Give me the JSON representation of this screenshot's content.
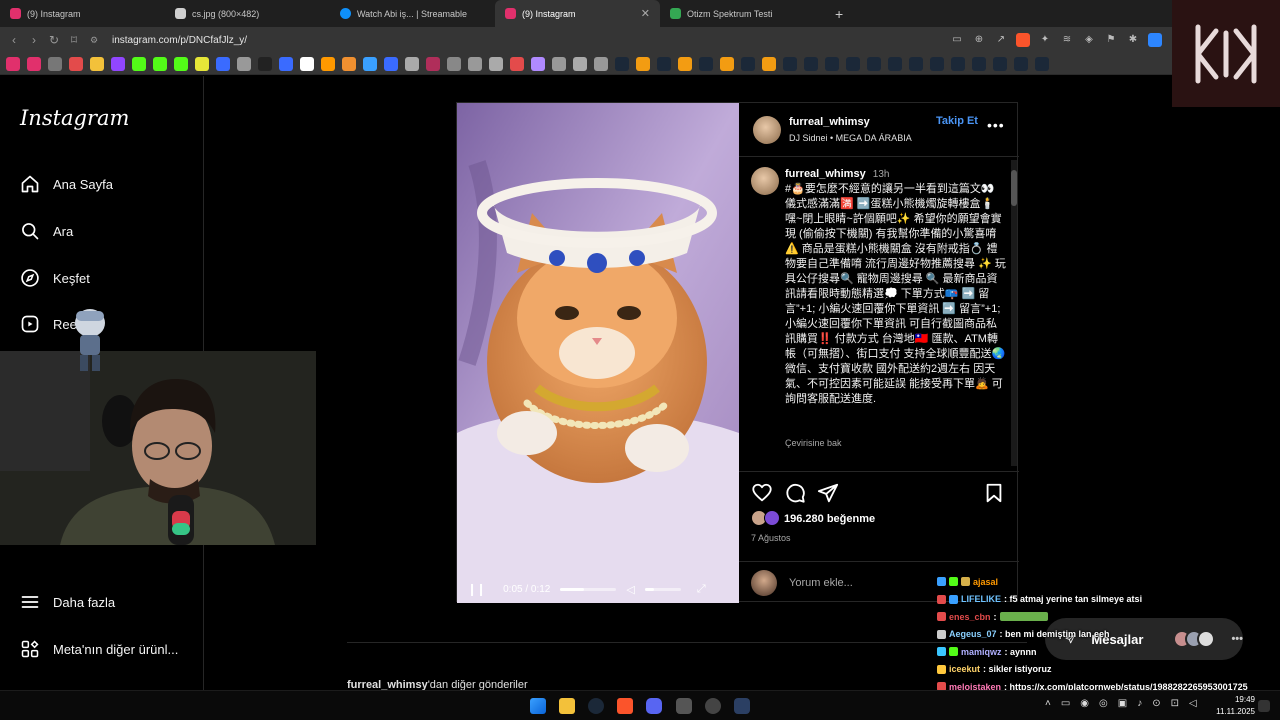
{
  "browser": {
    "tabs": [
      {
        "label": "(9) Instagram",
        "color": "#e1306c",
        "active": false
      },
      {
        "label": "cs.jpg (800×482)",
        "color": "#cfcfcf",
        "active": false
      },
      {
        "label": "Watch Abi iş... | Streamable",
        "color": "#0f90fa",
        "active": false
      },
      {
        "label": "(9) Instagram",
        "color": "#e1306c",
        "active": true
      },
      {
        "label": "Otizm Spektrum Testi",
        "color": "#34a853",
        "active": false
      }
    ],
    "url": "instagram.com/p/DNCfafJlz_y/"
  },
  "sidebar": {
    "logo": "Instagram",
    "items": [
      {
        "label": "Ana Sayfa",
        "icon": "home-icon"
      },
      {
        "label": "Ara",
        "icon": "search-icon"
      },
      {
        "label": "Keşfet",
        "icon": "compass-icon"
      },
      {
        "label": "Reels",
        "icon": "reels-icon"
      }
    ],
    "more": "Daha fazla",
    "meta": "Meta'nın diğer ürünl..."
  },
  "post": {
    "username": "furreal_whimsy",
    "follow": "Takip Et",
    "audio": "DJ Sidnei • MEGA DA ÁRABIA",
    "caption_time": "13h",
    "caption": "#🎂要怎麼不經意的讓另一半看到這篇文👀 儀式感滿滿🈵 ➡️蛋糕小熊機燭旋轉樓盒🕯️ 嘿~閉上眼睛~許個願吧✨ 希望你的願望會實現 (偷偷按下機關) 有我幫你準備的小驚喜唷 ⚠️ 商品是蛋糕小熊機關盒 沒有附戒指💍 禮物要自己準備唷 流行周邊好物推薦搜尋 ✨ 玩具公仔搜尋🔍 寵物周邊搜尋 🔍 最新商品資訊請看限時動態精選💭 下單方式📪 ➡️ 留言”+1; 小編火速回覆你下單資訊 ➡️ 留言”+1; 小編火速回覆你下單資訊 可自行截圖商品私訊購買‼️ 付款方式 台灣地🇹🇼 匯款、ATM轉帳（可無摺）、街口支付 支持全球順豐配送🌏微信、支付寶收款 國外配送約2週左右 因天氣、不可控因素可能延誤 能接受再下單🙇 可詢問客服配送進度.",
    "see_translation": "Çevirisine bak",
    "likes": "196.280 beğenme",
    "date": "7 Ağustos",
    "comment_placeholder": "Yorum ekle...",
    "video_time": "0:05 / 0:12",
    "video_progress": 0.42,
    "volume_level": 0.25,
    "more_posts_user": "furreal_whimsy",
    "more_posts_suffix": "'dan diğer gönderiler"
  },
  "messages": {
    "label": "Mesajlar"
  },
  "chat": [
    {
      "user": "ajasal",
      "text": "",
      "color": "#ff9900"
    },
    {
      "user": "LIFELIKE",
      "text": ": f5 atmaj yerine tan silmeye atsi",
      "color": "#6fc3ff"
    },
    {
      "user": "enes_cbn",
      "text": ": ",
      "color": "#e14b4b"
    },
    {
      "user": "Aegeus_07",
      "text": ": ben mi demiştim lan eeh",
      "color": "#8ad0ff"
    },
    {
      "user": "mamiqwz",
      "text": ": aynnn",
      "color": "#b0b0ff"
    },
    {
      "user": "iceekut",
      "text": ": sikler istiyoruz",
      "color": "#ffd36a"
    },
    {
      "user": "meloistaken",
      "text": ": https://x.com/platcornweb/status/1988282265953001725",
      "color": "#ff7ab6"
    }
  ],
  "clock": {
    "time": "19:49",
    "date": "11.11.2025"
  }
}
